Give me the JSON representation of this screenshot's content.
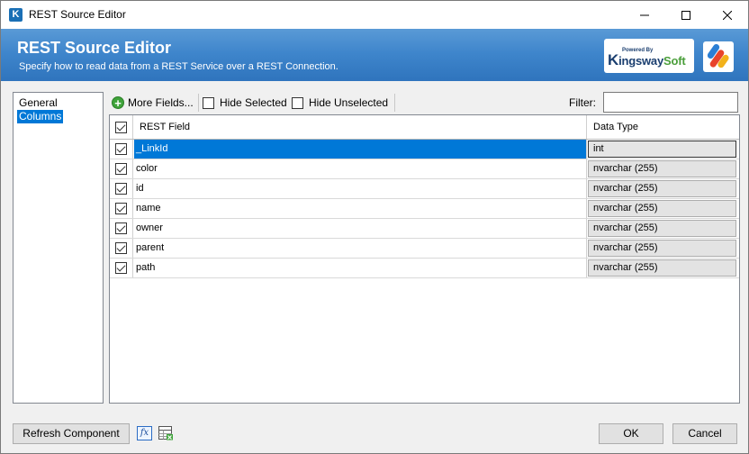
{
  "window": {
    "title": "REST Source Editor",
    "icon_letter": "K"
  },
  "banner": {
    "title": "REST Source Editor",
    "subtitle": "Specify how to read data from a REST Service over a REST Connection.",
    "powered_by": "Powered By",
    "brand_k": "K",
    "brand_ingsway": "ingsway",
    "brand_soft": "Soft"
  },
  "nav": {
    "items": [
      {
        "label": "General",
        "selected": false
      },
      {
        "label": "Columns",
        "selected": true
      }
    ]
  },
  "toolbar": {
    "more_fields": "More Fields...",
    "hide_selected": "Hide Selected",
    "hide_unselected": "Hide Unselected",
    "filter_label": "Filter:",
    "filter_value": ""
  },
  "grid": {
    "headers": {
      "field": "REST Field",
      "type": "Data Type"
    },
    "rows": [
      {
        "field": "_LinkId",
        "type": "int",
        "checked": true,
        "selected": true
      },
      {
        "field": "color",
        "type": "nvarchar (255)",
        "checked": true,
        "selected": false
      },
      {
        "field": "id",
        "type": "nvarchar (255)",
        "checked": true,
        "selected": false
      },
      {
        "field": "name",
        "type": "nvarchar (255)",
        "checked": true,
        "selected": false
      },
      {
        "field": "owner",
        "type": "nvarchar (255)",
        "checked": true,
        "selected": false
      },
      {
        "field": "parent",
        "type": "nvarchar (255)",
        "checked": true,
        "selected": false
      },
      {
        "field": "path",
        "type": "nvarchar (255)",
        "checked": true,
        "selected": false
      }
    ]
  },
  "footer": {
    "refresh": "Refresh Component",
    "fx": "fx",
    "ok": "OK",
    "cancel": "Cancel"
  },
  "colors": {
    "accent": "#0078d7",
    "banner": "#3f86cc",
    "brand_green": "#4a9e3a"
  }
}
